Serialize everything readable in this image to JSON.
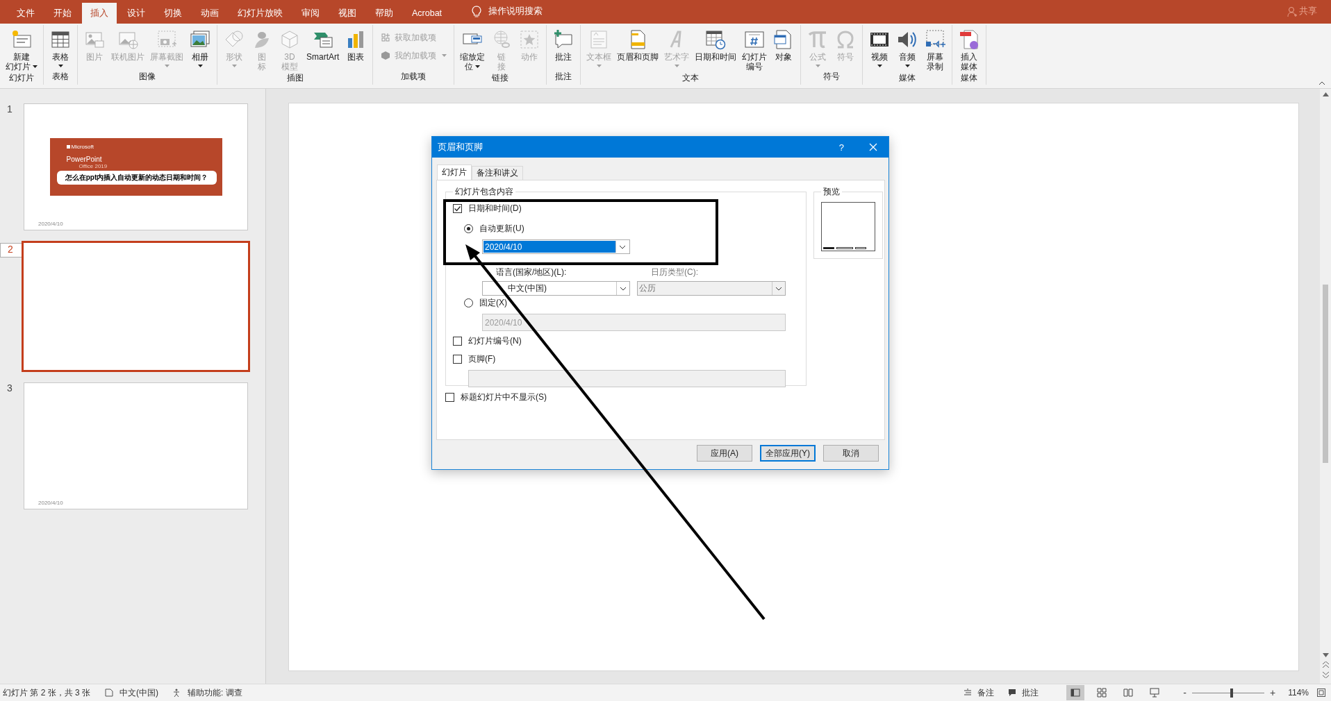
{
  "tabs": [
    {
      "label": "文件",
      "selected": false
    },
    {
      "label": "开始",
      "selected": false
    },
    {
      "label": "插入",
      "selected": true
    },
    {
      "label": "设计",
      "selected": false
    },
    {
      "label": "切换",
      "selected": false
    },
    {
      "label": "动画",
      "selected": false
    },
    {
      "label": "幻灯片放映",
      "selected": false
    },
    {
      "label": "审阅",
      "selected": false
    },
    {
      "label": "视图",
      "selected": false
    },
    {
      "label": "帮助",
      "selected": false
    },
    {
      "label": "Acrobat",
      "selected": false
    }
  ],
  "tell_me": "操作说明搜索",
  "share": "共享",
  "ribbon": [
    {
      "label": "幻灯片",
      "buttons": [
        {
          "kind": "large",
          "label": [
            "新建",
            "幻灯片"
          ],
          "disabled": false,
          "dropdown": true
        }
      ]
    },
    {
      "label": "表格",
      "buttons": [
        {
          "kind": "large",
          "label": [
            "表格"
          ],
          "disabled": false,
          "dropdown": true
        }
      ]
    },
    {
      "label": "图像",
      "buttons": [
        {
          "kind": "large",
          "label": [
            "图片"
          ],
          "disabled": true,
          "dropdown": false
        },
        {
          "kind": "large",
          "label": [
            "联机图片"
          ],
          "disabled": true,
          "dropdown": false
        },
        {
          "kind": "large",
          "label": [
            "屏幕截图"
          ],
          "disabled": true,
          "dropdown": true
        },
        {
          "kind": "large",
          "label": [
            "相册"
          ],
          "disabled": false,
          "dropdown": true
        }
      ]
    },
    {
      "label": "插图",
      "buttons": [
        {
          "kind": "large",
          "label": [
            "形状"
          ],
          "disabled": true,
          "dropdown": true
        },
        {
          "kind": "large",
          "label": [
            "图",
            "标"
          ],
          "disabled": true,
          "dropdown": false
        },
        {
          "kind": "large",
          "label": [
            "3D",
            "模型"
          ],
          "disabled": true,
          "dropdown": false
        },
        {
          "kind": "large",
          "label": [
            "SmartArt"
          ],
          "disabled": false,
          "dropdown": false
        },
        {
          "kind": "large",
          "label": [
            "图表"
          ],
          "disabled": false,
          "dropdown": false
        }
      ]
    },
    {
      "label": "加载项",
      "buttons": [
        {
          "kind": "small",
          "label": [
            "获取加载项"
          ],
          "disabled": true,
          "dropdown": false
        },
        {
          "kind": "small",
          "label": [
            "我的加载项"
          ],
          "disabled": true,
          "dropdown": true
        }
      ]
    },
    {
      "label": "链接",
      "buttons": [
        {
          "kind": "large",
          "label": [
            "缩放定",
            "位"
          ],
          "disabled": false,
          "dropdown": true
        },
        {
          "kind": "large",
          "label": [
            "链",
            "接"
          ],
          "disabled": true,
          "dropdown": false
        },
        {
          "kind": "large",
          "label": [
            "动作"
          ],
          "disabled": true,
          "dropdown": false
        }
      ]
    },
    {
      "label": "批注",
      "buttons": [
        {
          "kind": "large",
          "label": [
            "批注"
          ],
          "disabled": false,
          "dropdown": false
        }
      ]
    },
    {
      "label": "文本",
      "buttons": [
        {
          "kind": "large",
          "label": [
            "文本框"
          ],
          "disabled": true,
          "dropdown": true
        },
        {
          "kind": "large",
          "label": [
            "页眉和页脚"
          ],
          "disabled": false,
          "dropdown": false
        },
        {
          "kind": "large",
          "label": [
            "艺术字"
          ],
          "disabled": true,
          "dropdown": true
        },
        {
          "kind": "large",
          "label": [
            "日期和时间"
          ],
          "disabled": false,
          "dropdown": false
        },
        {
          "kind": "large",
          "label": [
            "幻灯片",
            "编号"
          ],
          "disabled": false,
          "dropdown": false
        },
        {
          "kind": "large",
          "label": [
            "对象"
          ],
          "disabled": false,
          "dropdown": false
        }
      ]
    },
    {
      "label": "符号",
      "buttons": [
        {
          "kind": "large",
          "label": [
            "公式"
          ],
          "disabled": true,
          "dropdown": true
        },
        {
          "kind": "large",
          "label": [
            "符号"
          ],
          "disabled": true,
          "dropdown": false
        }
      ]
    },
    {
      "label": "媒体",
      "buttons": [
        {
          "kind": "large",
          "label": [
            "视频"
          ],
          "disabled": false,
          "dropdown": true
        },
        {
          "kind": "large",
          "label": [
            "音频"
          ],
          "disabled": false,
          "dropdown": true
        },
        {
          "kind": "large",
          "label": [
            "屏幕",
            "录制"
          ],
          "disabled": false,
          "dropdown": false
        }
      ]
    },
    {
      "label": "媒体",
      "buttons": [
        {
          "kind": "large",
          "label": [
            "插入",
            "媒体"
          ],
          "disabled": false,
          "dropdown": false
        }
      ]
    }
  ],
  "slides": [
    {
      "number": "1",
      "selected": false,
      "kind": "title",
      "brand": "Microsoft",
      "product": "PowerPoint",
      "edition": "Office 2019",
      "title": "怎么在ppt内插入自动更新的动态日期和时间？",
      "footer_date": "2020/4/10"
    },
    {
      "number": "2",
      "selected": true,
      "kind": "blank"
    },
    {
      "number": "3",
      "selected": false,
      "kind": "blank",
      "footer_date": "2020/4/10"
    }
  ],
  "dialog": {
    "title": "页眉和页脚",
    "help": "?",
    "tabs": [
      {
        "label": "幻灯片",
        "selected": true
      },
      {
        "label": "备注和讲义",
        "selected": false
      }
    ],
    "content_group": "幻灯片包含内容",
    "date_time": {
      "label": "日期和时间(D)",
      "checked": true
    },
    "auto_update": {
      "label": "自动更新(U)",
      "selected": true
    },
    "auto_date": "2020/4/10",
    "language_label": "语言(国家/地区)(L):",
    "language": "中文(中国)",
    "calendar_label": "日历类型(C):",
    "calendar": "公历",
    "calendar_disabled": true,
    "fixed": {
      "label": "固定(X)",
      "selected": false
    },
    "fixed_date": "2020/4/10",
    "slide_number": {
      "label": "幻灯片编号(N)",
      "checked": false
    },
    "footer": {
      "label": "页脚(F)",
      "checked": false
    },
    "hide_on_title": {
      "label": "标题幻灯片中不显示(S)",
      "checked": false
    },
    "preview_label": "预览",
    "buttons": [
      {
        "label": "应用(A)",
        "default": false
      },
      {
        "label": "全部应用(Y)",
        "default": true
      },
      {
        "label": "取消",
        "default": false
      }
    ]
  },
  "status_bar": {
    "slide_position": "幻灯片 第 2 张，共 3 张",
    "language": "中文(中国)",
    "accessibility": "辅助功能: 调查",
    "notes": "备注",
    "comments": "批注",
    "views": [
      {
        "selected": true
      },
      {
        "selected": false
      },
      {
        "selected": false
      },
      {
        "selected": false
      }
    ],
    "zoom_out": "-",
    "zoom_in": "+",
    "zoom": {
      "level": 0.53
    },
    "zoom_percent": "114%"
  }
}
